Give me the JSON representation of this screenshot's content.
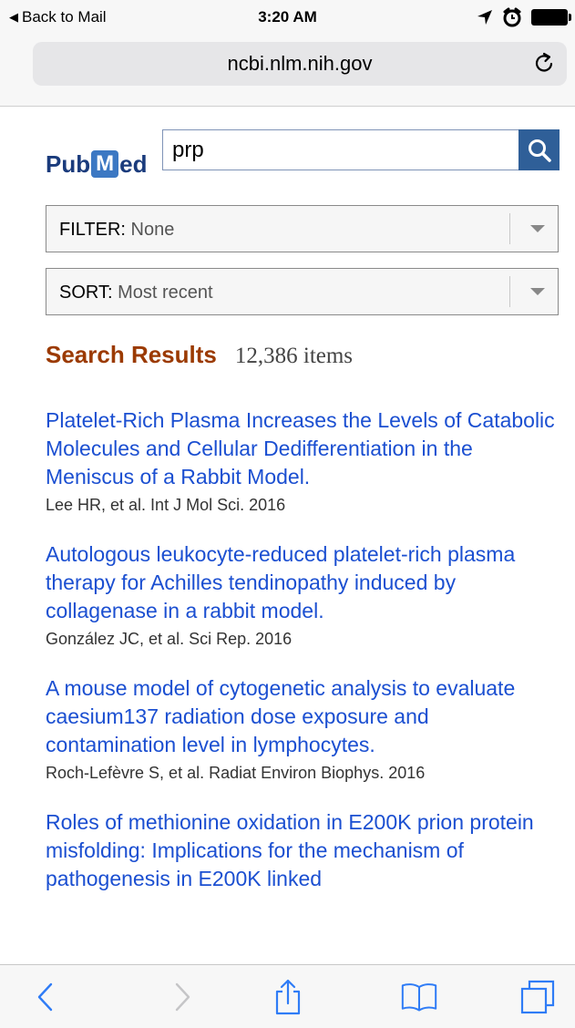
{
  "status_bar": {
    "back_label": "Back to Mail",
    "time": "3:20 AM"
  },
  "browser": {
    "url": "ncbi.nlm.nih.gov"
  },
  "pubmed": {
    "logo_pub": "Pub",
    "logo_m": "M",
    "logo_ed": "ed",
    "search_value": "prp",
    "filter_label": "FILTER:",
    "filter_value": "None",
    "sort_label": "SORT:",
    "sort_value": "Most recent"
  },
  "results": {
    "heading": "Search Results",
    "count": "12,386 items",
    "items": [
      {
        "title": "Platelet-Rich Plasma Increases the Levels of Catabolic Molecules and Cellular Dedifferentiation in the Meniscus of a Rabbit Model.",
        "citation": "Lee HR, et al. Int J Mol Sci. 2016"
      },
      {
        "title": "Autologous leukocyte-reduced platelet-rich plasma therapy for Achilles tendinopathy induced by collagenase in a rabbit model.",
        "citation": "González JC, et al. Sci Rep. 2016"
      },
      {
        "title": "A mouse model of cytogenetic analysis to evaluate caesium137 radiation dose exposure and contamination level in lymphocytes.",
        "citation": "Roch-Lefèvre S, et al. Radiat Environ Biophys. 2016"
      },
      {
        "title": "Roles of methionine oxidation in E200K prion protein misfolding: Implications for the mechanism of pathogenesis in E200K linked",
        "citation": ""
      }
    ]
  },
  "colors": {
    "link": "#1b4fd1",
    "heading": "#9b3a00",
    "logo": "#1a3b7c",
    "search_button": "#2f5f98",
    "ios_blue": "#2f7cf6"
  },
  "icons": {
    "back": "chevron-left-icon",
    "forward": "chevron-right-icon",
    "share": "share-icon",
    "bookmarks": "book-icon",
    "tabs": "tabs-icon",
    "reload": "reload-icon",
    "search": "magnifier-icon"
  }
}
